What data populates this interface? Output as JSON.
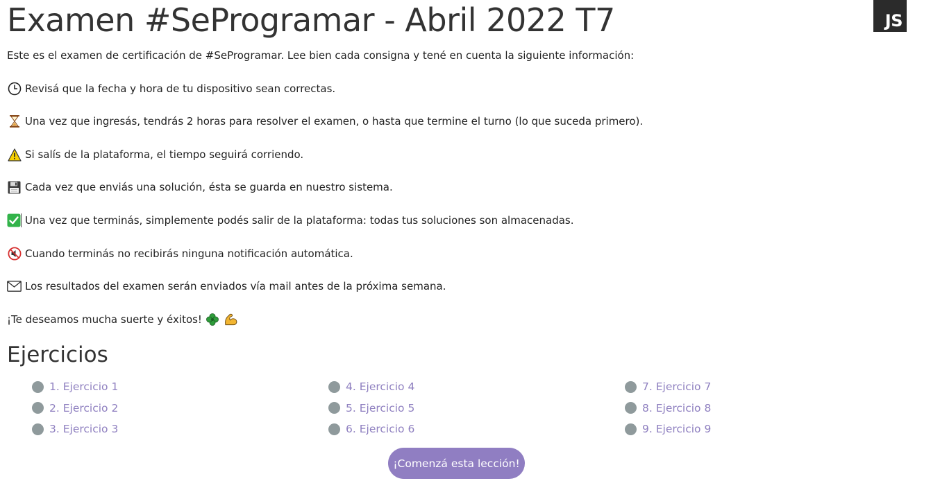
{
  "header": {
    "title": "Examen #SeProgramar - Abril 2022 T7",
    "badge": "JS"
  },
  "intro": "Este es el examen de certificación de #SeProgramar. Lee bien cada consigna y tené en cuenta la siguiente información:",
  "info_items": [
    {
      "icon": "clock-icon",
      "text": "Revisá que la fecha y hora de tu dispositivo sean correctas."
    },
    {
      "icon": "hourglass-icon",
      "text": "Una vez que ingresás, tendrás 2 horas para resolver el examen, o hasta que termine el turno (lo que suceda primero)."
    },
    {
      "icon": "warning-icon",
      "text": "Si salís de la plataforma, el tiempo seguirá corriendo."
    },
    {
      "icon": "floppy-disk-icon",
      "text": "Cada vez que enviás una solución, ésta se guarda en nuestro sistema."
    },
    {
      "icon": "check-mark-icon",
      "text": "Una vez que terminás, simplemente podés salir de la plataforma: todas tus soluciones son almacenadas."
    },
    {
      "icon": "muted-speaker-icon",
      "text": "Cuando terminás no recibirás ninguna notificación automática."
    },
    {
      "icon": "envelope-icon",
      "text": "Los resultados del examen serán enviados vía mail antes de la próxima semana."
    }
  ],
  "closing": {
    "text": "¡Te deseamos mucha suerte y éxitos!",
    "icons": [
      "four-leaf-clover-icon",
      "flexed-biceps-icon"
    ]
  },
  "exercises": {
    "heading": "Ejercicios",
    "items": [
      "1. Ejercicio 1",
      "2. Ejercicio 2",
      "3. Ejercicio 3",
      "4. Ejercicio 4",
      "5. Ejercicio 5",
      "6. Ejercicio 6",
      "7. Ejercicio 7",
      "8. Ejercicio 8",
      "9. Ejercicio 9"
    ]
  },
  "start_button": "¡Comenzá esta lección!",
  "colors": {
    "accent": "#907ec2",
    "link": "#8f80c0",
    "status_dot": "#8f9a9c",
    "badge_bg": "#2b2b2b"
  }
}
